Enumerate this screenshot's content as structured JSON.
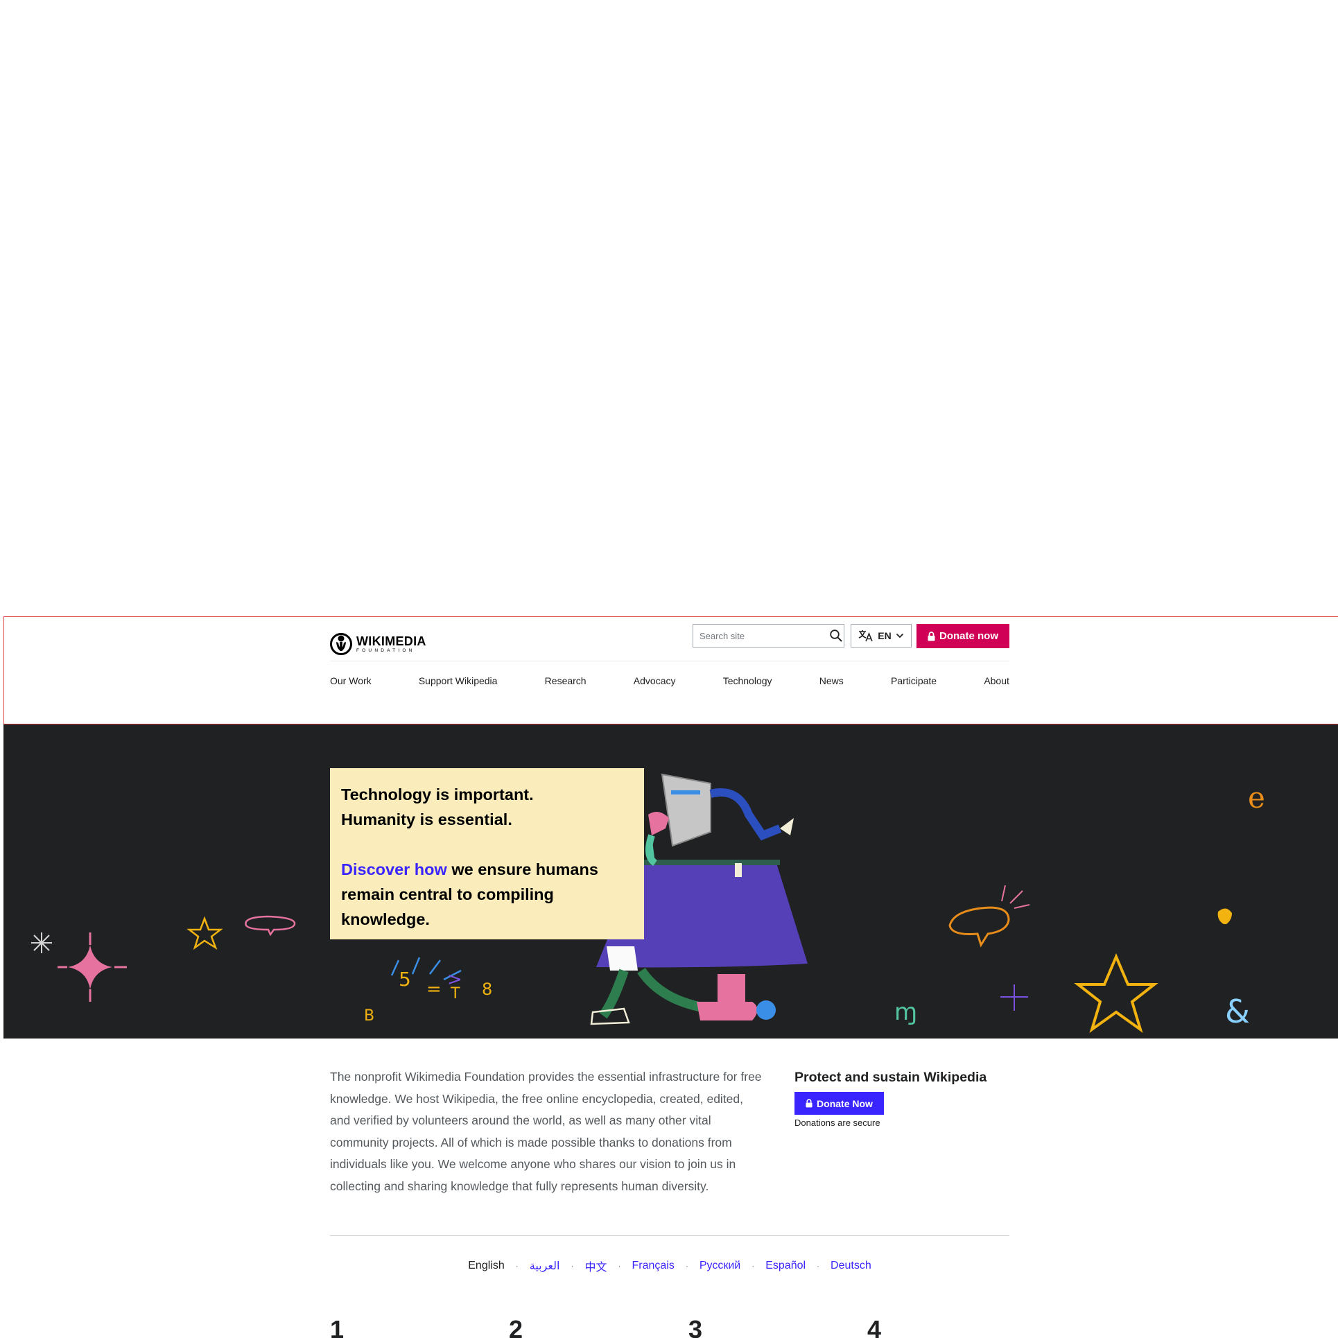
{
  "header": {
    "logo_word": "WIKIMEDIA",
    "logo_sub": "FOUNDATION",
    "search_placeholder": "Search site",
    "language_code": "EN",
    "donate_label": "Donate now",
    "nav": [
      "Our Work",
      "Support Wikipedia",
      "Research",
      "Advocacy",
      "Technology",
      "News",
      "Participate",
      "About"
    ]
  },
  "hero": {
    "line1": "Technology is important.",
    "line2": "Humanity is essential.",
    "link_text": "Discover how",
    "rest_text": " we ensure humans remain central to compiling knowledge."
  },
  "intro": {
    "text": "The nonprofit Wikimedia Foundation provides the essential infrastructure for free knowledge. We host Wikipedia, the free online encyclopedia, created, edited, and verified by volunteers around the world, as well as many other vital community projects. All of which is made possible thanks to donations from individuals like you. We welcome anyone who shares our vision to join us in collecting and sharing knowledge that fully represents human diversity."
  },
  "aside": {
    "heading": "Protect and sustain Wikipedia",
    "donate_label": "Donate Now",
    "secure_note": "Donations are secure"
  },
  "languages": {
    "current": "English",
    "others": [
      "العربية",
      "中文",
      "Français",
      "Русский",
      "Español",
      "Deutsch"
    ]
  },
  "stats_numbers": [
    "1",
    "2",
    "3",
    "4"
  ],
  "colors": {
    "donate_primary": "#d10057",
    "accent_blue": "#3a25ff",
    "hero_bg": "#202122",
    "hero_box": "#fbedbb"
  }
}
